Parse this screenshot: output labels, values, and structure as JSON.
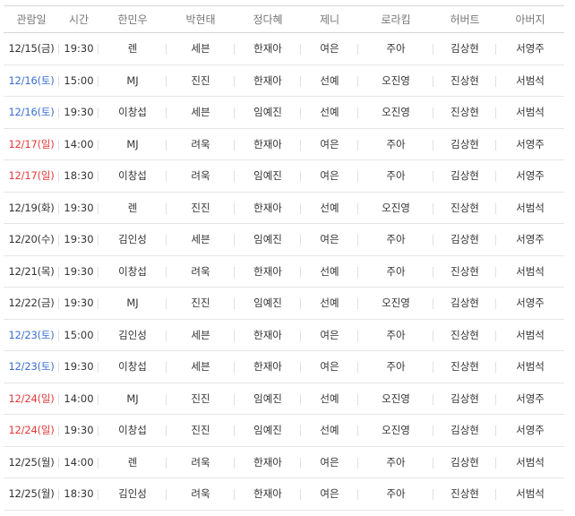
{
  "colors": {
    "saturday": "#3c6fd1",
    "sunday": "#e23b3b",
    "weekday": "#333333"
  },
  "table": {
    "headers": [
      "관람일",
      "시간",
      "한민우",
      "박현태",
      "정다혜",
      "제니",
      "로라킴",
      "허버트",
      "아버지"
    ],
    "rows": [
      {
        "date": "12/15(금)",
        "day": "weekday",
        "time": "19:30",
        "cast": [
          "렌",
          "세븐",
          "한재아",
          "여은",
          "주아",
          "김상현",
          "서영주"
        ]
      },
      {
        "date": "12/16(토)",
        "day": "saturday",
        "time": "15:00",
        "cast": [
          "MJ",
          "진진",
          "한재아",
          "선예",
          "오진영",
          "진상현",
          "서범석"
        ]
      },
      {
        "date": "12/16(토)",
        "day": "saturday",
        "time": "19:30",
        "cast": [
          "이창섭",
          "세븐",
          "임예진",
          "선예",
          "오진영",
          "진상현",
          "서범석"
        ]
      },
      {
        "date": "12/17(일)",
        "day": "sunday",
        "time": "14:00",
        "cast": [
          "MJ",
          "려욱",
          "한재아",
          "여은",
          "주아",
          "김상현",
          "서영주"
        ]
      },
      {
        "date": "12/17(일)",
        "day": "sunday",
        "time": "18:30",
        "cast": [
          "이창섭",
          "려욱",
          "임예진",
          "여은",
          "주아",
          "김상현",
          "서영주"
        ]
      },
      {
        "date": "12/19(화)",
        "day": "weekday",
        "time": "19:30",
        "cast": [
          "렌",
          "진진",
          "한재아",
          "선예",
          "오진영",
          "진상현",
          "서범석"
        ]
      },
      {
        "date": "12/20(수)",
        "day": "weekday",
        "time": "19:30",
        "cast": [
          "김인성",
          "세븐",
          "임예진",
          "여은",
          "주아",
          "김상현",
          "서영주"
        ]
      },
      {
        "date": "12/21(목)",
        "day": "weekday",
        "time": "19:30",
        "cast": [
          "이창섭",
          "려욱",
          "한재아",
          "선예",
          "주아",
          "진상현",
          "서범석"
        ]
      },
      {
        "date": "12/22(금)",
        "day": "weekday",
        "time": "19:30",
        "cast": [
          "MJ",
          "진진",
          "임예진",
          "선예",
          "오진영",
          "김상현",
          "서영주"
        ]
      },
      {
        "date": "12/23(토)",
        "day": "saturday",
        "time": "15:00",
        "cast": [
          "김인성",
          "세븐",
          "한재아",
          "여은",
          "주아",
          "진상현",
          "서범석"
        ]
      },
      {
        "date": "12/23(토)",
        "day": "saturday",
        "time": "19:30",
        "cast": [
          "이창섭",
          "세븐",
          "한재아",
          "여은",
          "주아",
          "진상현",
          "서범석"
        ]
      },
      {
        "date": "12/24(일)",
        "day": "sunday",
        "time": "14:00",
        "cast": [
          "MJ",
          "진진",
          "임예진",
          "선예",
          "오진영",
          "김상현",
          "서영주"
        ]
      },
      {
        "date": "12/24(일)",
        "day": "sunday",
        "time": "19:30",
        "cast": [
          "이창섭",
          "진진",
          "임예진",
          "선예",
          "오진영",
          "김상현",
          "서영주"
        ]
      },
      {
        "date": "12/25(월)",
        "day": "weekday",
        "time": "14:00",
        "cast": [
          "렌",
          "려욱",
          "한재아",
          "여은",
          "주아",
          "김상현",
          "서범석"
        ]
      },
      {
        "date": "12/25(월)",
        "day": "weekday",
        "time": "18:30",
        "cast": [
          "김인성",
          "려욱",
          "한재아",
          "여은",
          "주아",
          "진상현",
          "서범석"
        ]
      }
    ]
  }
}
